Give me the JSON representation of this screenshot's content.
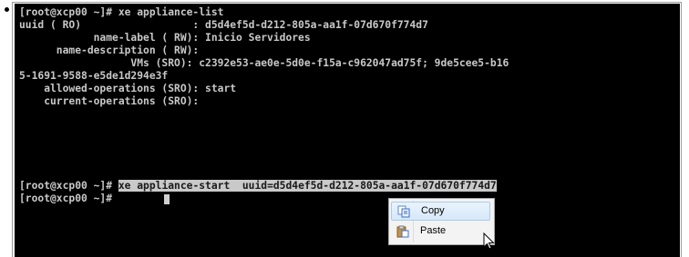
{
  "terminal": {
    "lines": [
      "[root@xcp00 ~]# xe appliance-list",
      "uuid ( RO)                  : d5d4ef5d-d212-805a-aa1f-07d670f774d7",
      "            name-label ( RW): Inicio Servidores",
      "      name-description ( RW):",
      "                  VMs (SRO): c2392e53-ae0e-5d0e-f15a-c962047ad75f; 9de5cee5-b16",
      "5-1691-9588-e5de1d294e3f",
      "    allowed-operations (SRO): start",
      "    current-operations (SRO):",
      "",
      ""
    ],
    "prompt": "[root@xcp00 ~]#",
    "selected_command": "xe appliance-start  uuid=d5d4ef5d-d212-805a-aa1f-07d670f774d7",
    "prompt2": "[root@xcp00 ~]#"
  },
  "context_menu": {
    "items": [
      {
        "label": "Copy",
        "icon": "copy-icon"
      },
      {
        "label": "Paste",
        "icon": "paste-icon"
      }
    ]
  },
  "colors": {
    "terminal_bg": "#000000",
    "terminal_fg": "#c8c8c8",
    "selection_bg": "#c9c9c9",
    "menu_hover": "#d7e8f9"
  }
}
